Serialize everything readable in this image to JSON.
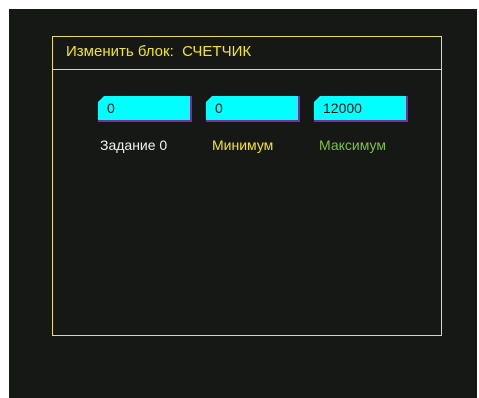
{
  "dialog": {
    "title": "Изменить блок:  СЧЕТЧИК"
  },
  "fields": [
    {
      "value": "0",
      "label": "Задание 0",
      "label_color": "#f0f0f0"
    },
    {
      "value": "0",
      "label": "Минимум",
      "label_color": "#f4e41c"
    },
    {
      "value": "12000",
      "label": "Максимум",
      "label_color": "#7cc043"
    }
  ],
  "colors": {
    "background": "#161816",
    "border": "#e8de5c",
    "field_fill": "#00ffff",
    "field_shadow": "#7a2e9e"
  }
}
